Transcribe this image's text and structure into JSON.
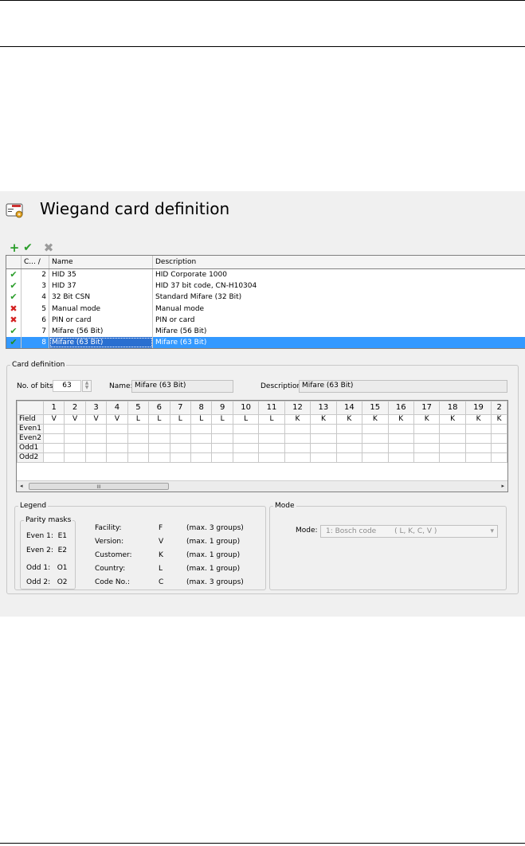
{
  "window": {
    "title": "Wiegand card definition"
  },
  "toolbar": {
    "add_glyph": "+",
    "accept_glyph": "✔",
    "delete_glyph": "✖"
  },
  "grid": {
    "columns": [
      "C... /",
      "Name",
      "Description"
    ],
    "rows": [
      {
        "status": "✔",
        "code": "2",
        "name": "HID 35",
        "description": "HID Corporate 1000"
      },
      {
        "status": "✔",
        "code": "3",
        "name": "HID 37",
        "description": "HID 37 bit code, CN-H10304"
      },
      {
        "status": "✔",
        "code": "4",
        "name": "32 Bit CSN",
        "description": "Standard Mifare (32 Bit)"
      },
      {
        "status": "✖",
        "code": "5",
        "name": "Manual mode",
        "description": "Manual mode"
      },
      {
        "status": "✖",
        "code": "6",
        "name": "PIN or card",
        "description": "PIN or card"
      },
      {
        "status": "✔",
        "code": "7",
        "name": "Mifare (56 Bit)",
        "description": "Mifare (56 Bit)"
      },
      {
        "status": "✔",
        "code": "8",
        "name": "Mifare (63 Bit)",
        "description": "Mifare (63 Bit)"
      }
    ]
  },
  "card_definition": {
    "legend": "Card definition",
    "bits_label": "No. of bits:",
    "bits_value": "63",
    "name_label": "Name:",
    "name_value": "Mifare (63 Bit)",
    "description_label": "Description:",
    "description_value": "Mifare (63 Bit)",
    "bit_columns": [
      "1",
      "2",
      "3",
      "4",
      "5",
      "6",
      "7",
      "8",
      "9",
      "10",
      "11",
      "12",
      "13",
      "14",
      "15",
      "16",
      "17",
      "18",
      "19",
      "2"
    ],
    "row_labels": {
      "field": "Field",
      "even1": "Even1",
      "even2": "Even2",
      "odd1": "Odd1",
      "odd2": "Odd2"
    },
    "field_values": [
      "V",
      "V",
      "V",
      "V",
      "L",
      "L",
      "L",
      "L",
      "L",
      "L",
      "L",
      "K",
      "K",
      "K",
      "K",
      "K",
      "K",
      "K",
      "K",
      "K"
    ],
    "scroll": {
      "left": "◂",
      "thumb": "III",
      "right": "▸"
    }
  },
  "legend": {
    "title": "Legend",
    "parity_title": "Parity masks",
    "parity": [
      "Even 1:  E1",
      "Even 2:  E2",
      "Odd 1:   O1",
      "Odd 2:   O2"
    ],
    "codes": [
      {
        "name": "Facility:",
        "code": "F",
        "limit": "(max. 3 groups)"
      },
      {
        "name": "Version:",
        "code": "V",
        "limit": "(max. 1 group)"
      },
      {
        "name": "Customer:",
        "code": "K",
        "limit": "(max. 1 group)"
      },
      {
        "name": "Country:",
        "code": "L",
        "limit": "(max. 1 group)"
      },
      {
        "name": "Code No.:",
        "code": "C",
        "limit": "(max. 3 groups)"
      }
    ]
  },
  "mode": {
    "title": "Mode",
    "label": "Mode:",
    "value": "1: Bosch code        ( L, K, C, V )",
    "arrow": "▾"
  },
  "colors": {
    "selection": "#3399ff",
    "check": "#2a9d2a",
    "cross": "#d42020",
    "panel": "#f0f0f0"
  },
  "icons": {
    "title": "wiegand-card-icon",
    "add": "plus-icon",
    "accept": "check-icon",
    "delete": "delete-icon"
  }
}
